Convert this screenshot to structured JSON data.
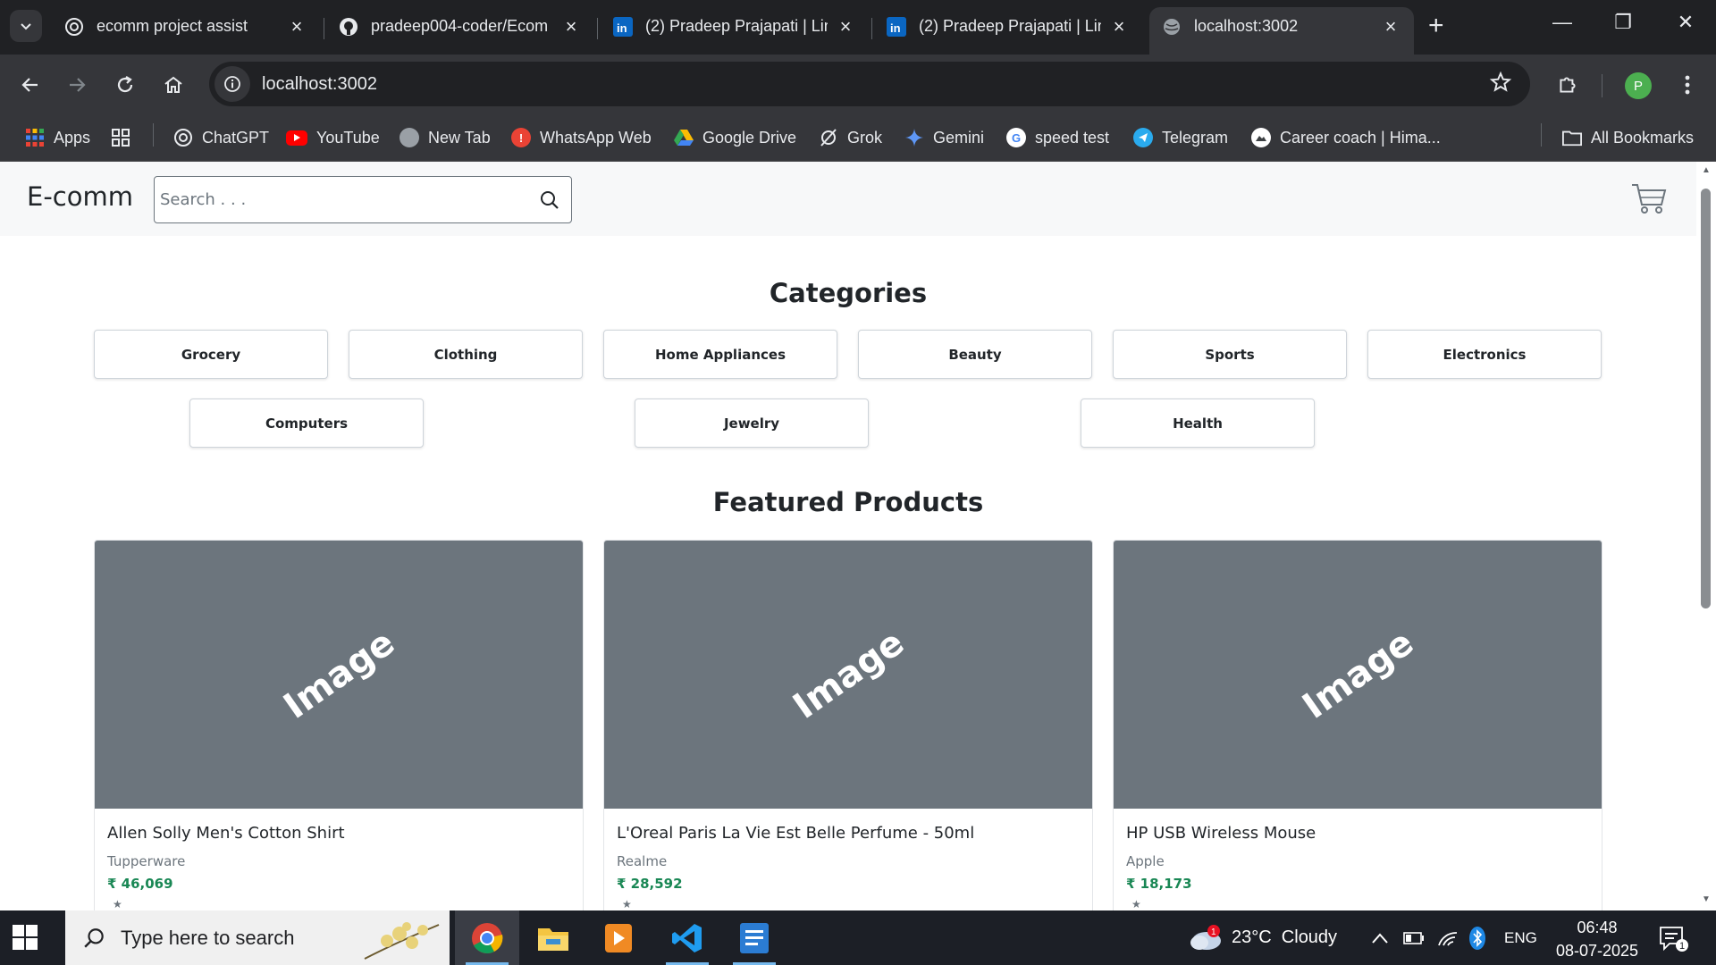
{
  "browser": {
    "tabs": [
      {
        "title": "ecomm project assist",
        "icon": "chatgpt-icon"
      },
      {
        "title": "pradeep004-coder/Ecom",
        "icon": "github-icon"
      },
      {
        "title": "(2) Pradeep Prajapati | Lin",
        "icon": "linkedin-icon"
      },
      {
        "title": "(2) Pradeep Prajapati | Lin",
        "icon": "linkedin-icon"
      },
      {
        "title": "localhost:3002",
        "icon": "globe-icon",
        "active": true
      }
    ],
    "url": "localhost:3002",
    "profile_initial": "P",
    "bookmarks": [
      {
        "label": "Apps"
      },
      {
        "label": "ChatGPT"
      },
      {
        "label": "YouTube"
      },
      {
        "label": "New Tab"
      },
      {
        "label": "WhatsApp Web"
      },
      {
        "label": "Google Drive"
      },
      {
        "label": "Grok"
      },
      {
        "label": "Gemini"
      },
      {
        "label": "speed test"
      },
      {
        "label": "Telegram"
      },
      {
        "label": "Career coach | Hima..."
      }
    ],
    "all_bookmarks": "All Bookmarks"
  },
  "site": {
    "brand": "E-comm",
    "search_placeholder": "Search . . .",
    "categories_title": "Categories",
    "categories": [
      "Grocery",
      "Clothing",
      "Home Appliances",
      "Beauty",
      "Sports",
      "Electronics",
      "Computers",
      "Jewelry",
      "Health"
    ],
    "featured_title": "Featured Products",
    "products": [
      {
        "image_text": "Image",
        "name": "Allen Solly Men's Cotton Shirt",
        "brand": "Tupperware",
        "price": "₹ 46,069"
      },
      {
        "image_text": "Image",
        "name": "L'Oreal Paris La Vie Est Belle Perfume - 50ml",
        "brand": "Realme",
        "price": "₹ 28,592"
      },
      {
        "image_text": "Image",
        "name": "HP USB Wireless Mouse",
        "brand": "Apple",
        "price": "₹ 18,173"
      }
    ],
    "colors": {
      "price": "#198754",
      "image_bg": "#6c757d"
    }
  },
  "taskbar": {
    "search_placeholder": "Type here to search",
    "weather": "23°C  Cloudy",
    "weather_badge": "1",
    "language": "ENG",
    "time": "06:48",
    "date": "08-07-2025",
    "notification_count": "1"
  }
}
